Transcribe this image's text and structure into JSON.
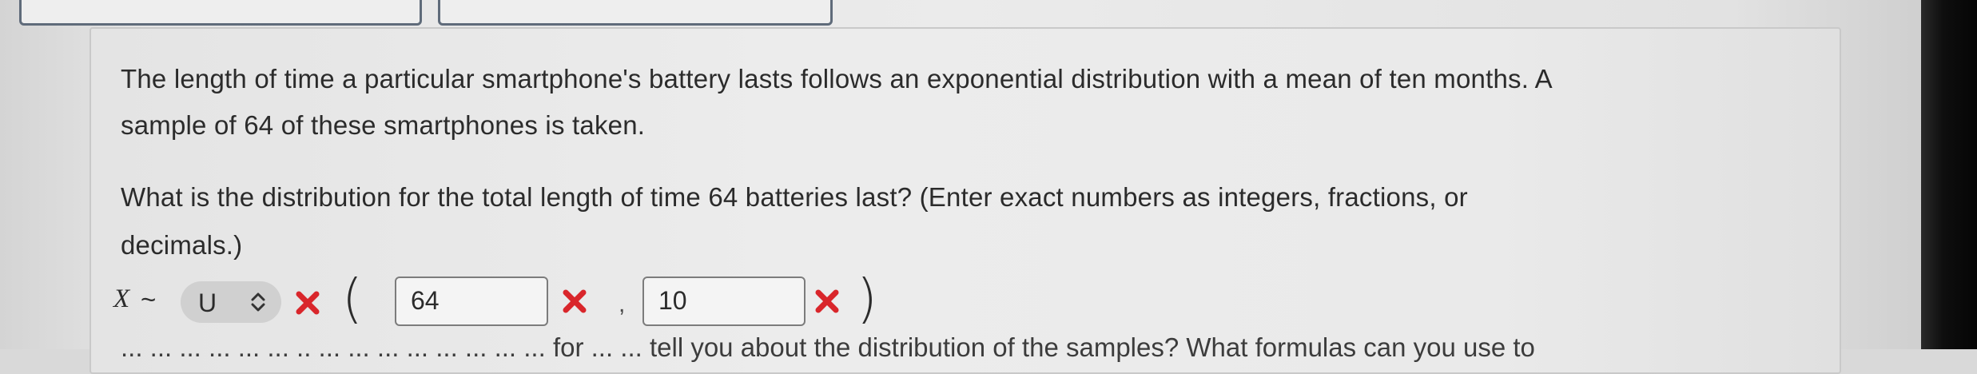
{
  "question": {
    "paragraph1_line1": "The length of time a particular smartphone's battery lasts follows an exponential distribution with a mean of ten months. A",
    "paragraph1_line2": "sample of 64 of these smartphones is taken.",
    "paragraph2_line1": "What is the distribution for the total length of time 64 batteries last? (Enter exact numbers as integers, fractions, or",
    "paragraph2_line2": "decimals.)",
    "next_line_partial": "... ... ... ...  ... ... ..  ... ... ...  ... ...  ... ... ...  for ... ... tell you about the distribution of the samples? What formulas can you use to"
  },
  "answer": {
    "variable": "X",
    "tilde": "~",
    "distribution_select_value": "U",
    "open_paren": "(",
    "param1_value": "64",
    "comma": ",",
    "param2_value": "10",
    "close_paren": ")"
  },
  "icons": {
    "select_chevron": "up-down-chevron-icon",
    "incorrect": "red-x-icon"
  },
  "colors": {
    "incorrect_red": "#d9262b",
    "text": "#2b2b2b"
  }
}
